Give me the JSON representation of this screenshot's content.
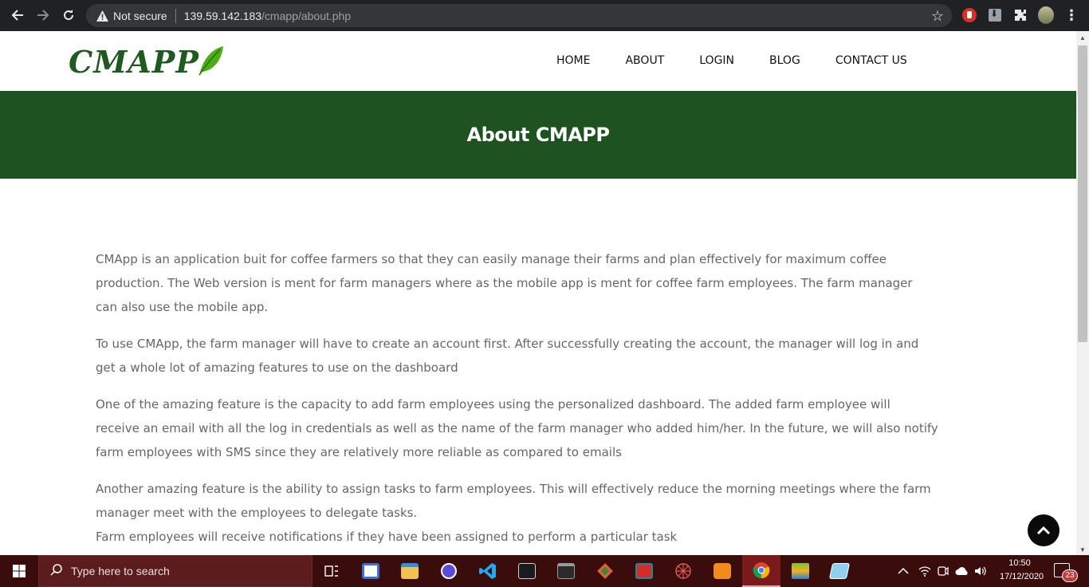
{
  "browser": {
    "security_label": "Not secure",
    "url_host": "139.59.142.183",
    "url_path": "/cmapp/about.php"
  },
  "site": {
    "logo_text": "CMAPP",
    "nav": [
      "HOME",
      "ABOUT",
      "LOGIN",
      "BLOG",
      "CONTACT US"
    ],
    "hero_title": "About CMAPP"
  },
  "content": {
    "paragraphs": [
      [
        "CMApp is an application buit for coffee farmers so that they can easily manage their farms and plan effectively for maximum coffee",
        "production. The Web version is ment for farm managers where as the mobile app is ment for coffee farm employees. The farm manager",
        "can also use the mobile app."
      ],
      [
        "To use CMApp, the farm manager will have to create an account first. After successfully creating the account, the manager will log in and",
        "get a whole lot of amazing features to use on the dashboard"
      ],
      [
        "One of the amazing feature is the capacity to add farm employees using the personalized dashboard. The added farm employee will",
        "receive an email with all the log in credentials as well as the name of the farm manager who added him/her. In the future, we will also notify",
        "farm employees with SMS since they are relatively more reliable as compared to emails"
      ],
      [
        "Another amazing feature is the ability to assign tasks to farm employees. This will effectively reduce the morning meetings where the farm",
        "manager meet with the employees to delegate tasks.",
        "Farm employees will receive notifications if they have been assigned to perform a particular task"
      ]
    ]
  },
  "taskbar": {
    "search_placeholder": "Type here to search",
    "time": "10:50",
    "date": "17/12/2020",
    "notification_count": "23"
  },
  "colors": {
    "brand_green": "#1e5220",
    "chrome_bg": "#202124",
    "taskbar_bg": "#3b0c0c"
  }
}
